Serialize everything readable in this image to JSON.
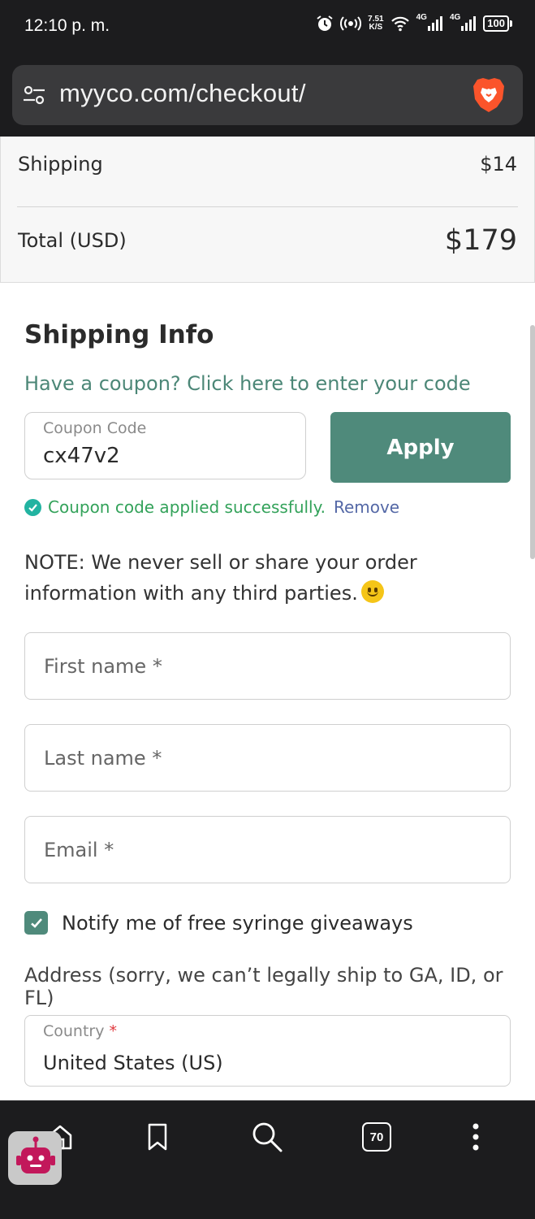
{
  "status_bar": {
    "time": "12:10 p. m.",
    "speed_value": "7.51",
    "speed_unit": "K/S",
    "net1": "4G",
    "net2": "4G",
    "battery": "100"
  },
  "url_bar": {
    "url": "myyco.com/checkout/"
  },
  "order_summary": {
    "shipping_label": "Shipping",
    "shipping_value": "$14",
    "total_label": "Total (USD)",
    "total_value": "$179"
  },
  "shipping_info": {
    "title": "Shipping Info",
    "coupon_prompt": "Have a coupon? Click here to enter your code",
    "coupon_label": "Coupon Code",
    "coupon_value": "cx47v2",
    "apply_label": "Apply",
    "success_message": "Coupon code applied successfully.",
    "remove_label": "Remove",
    "note_label": "NOTE:",
    "note_text": " We never sell or share your order information with any third parties.",
    "first_name_placeholder": "First name *",
    "last_name_placeholder": "Last name *",
    "email_placeholder": "Email *",
    "notify_label": "Notify me of free syringe giveaways",
    "notify_checked": true,
    "address_note": "Address (sorry, we can’t legally ship to GA, ID, or FL)",
    "country_label": "Country",
    "country_required": "*",
    "country_value": "United States (US)"
  },
  "bottom_nav": {
    "tab_count": "70"
  },
  "colors": {
    "accent": "#4f8a7b",
    "link": "#4c8777",
    "success": "#33a25a",
    "remove_link": "#5468a6",
    "required": "#e0393e"
  },
  "icons": {
    "status": [
      "alarm-icon",
      "hotspot-icon",
      "wifi-icon",
      "signal-icon",
      "battery-icon"
    ],
    "url_bar": [
      "site-settings-icon",
      "brave-lion-icon"
    ],
    "nav": [
      "home-icon",
      "bookmark-icon",
      "search-icon",
      "tabs-icon",
      "menu-icon"
    ]
  }
}
